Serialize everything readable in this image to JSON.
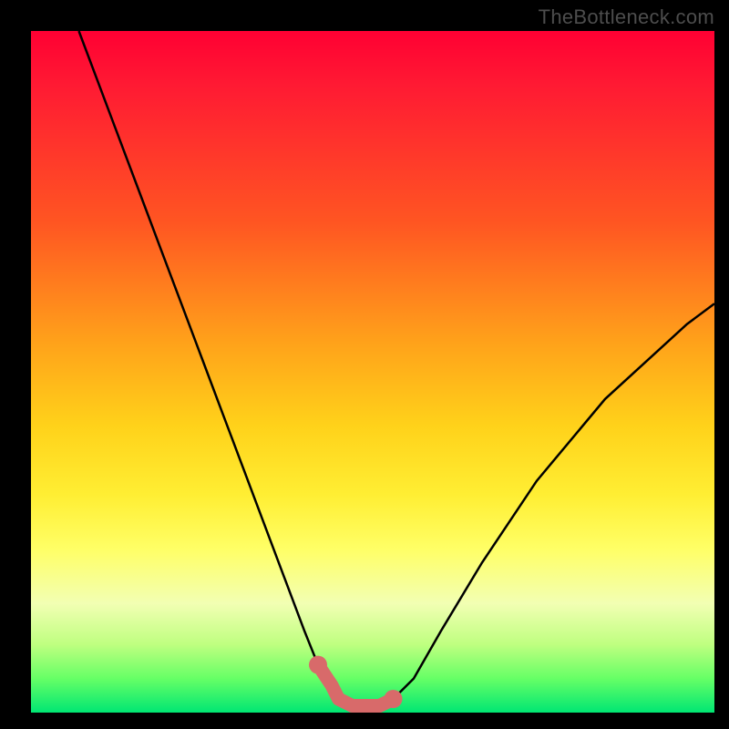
{
  "watermark": "TheBottleneck.com",
  "colors": {
    "background_black": "#000000",
    "curve_black": "#000000",
    "highlight_pink": "#d86a6a",
    "gradient_top": "#ff0033",
    "gradient_bottom": "#00e673"
  },
  "chart_data": {
    "type": "line",
    "title": "",
    "xlabel": "",
    "ylabel": "",
    "xlim": [
      0,
      100
    ],
    "ylim": [
      0,
      100
    ],
    "grid": false,
    "legend": false,
    "note": "x and y are normalized 0..100; y=0 is the bottom green band (minimum bottleneck), y=100 is top (maximum bottleneck). No numeric axis labels are rendered in the image.",
    "series": [
      {
        "name": "bottleneck-curve",
        "x": [
          7,
          10,
          13,
          16,
          19,
          22,
          25,
          28,
          31,
          34,
          37,
          40,
          42,
          44,
          45,
          47,
          49,
          51,
          53,
          56,
          60,
          66,
          74,
          84,
          96,
          100
        ],
        "y": [
          100,
          92,
          84,
          76,
          68,
          60,
          52,
          44,
          36,
          28,
          20,
          12,
          7,
          4,
          2,
          1,
          1,
          1,
          2,
          5,
          12,
          22,
          34,
          46,
          57,
          60
        ]
      },
      {
        "name": "minimum-highlight",
        "x": [
          42,
          44,
          45,
          47,
          49,
          51,
          53
        ],
        "y": [
          7,
          4,
          2,
          1,
          1,
          1,
          2
        ]
      }
    ]
  }
}
